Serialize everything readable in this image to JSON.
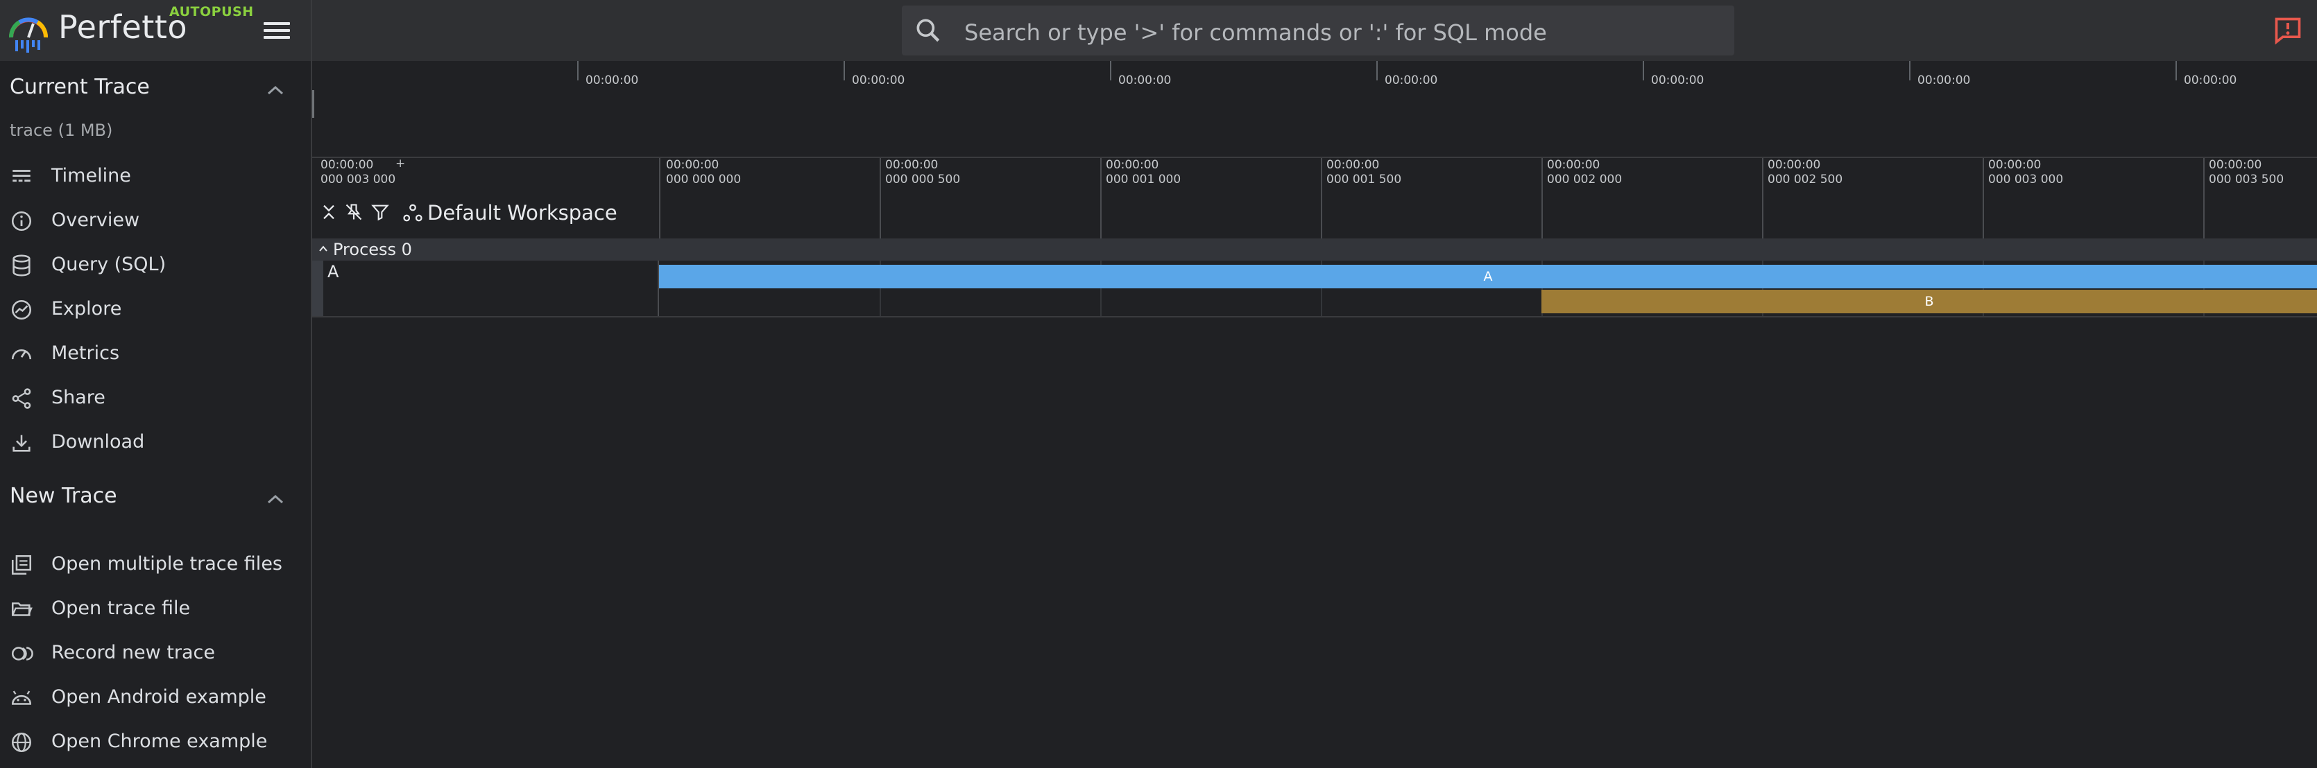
{
  "brand": {
    "name": "Perfetto",
    "channel": "AUTOPUSH",
    "channel_color": "#8bd13f"
  },
  "search": {
    "placeholder": "Search or type '>' for commands or ':' for SQL mode"
  },
  "sidebar": {
    "current_trace": {
      "title": "Current Trace",
      "trace_name": "trace (1 MB)",
      "items": [
        {
          "label": "Timeline",
          "icon": "timeline-icon"
        },
        {
          "label": "Overview",
          "icon": "info-icon"
        },
        {
          "label": "Query (SQL)",
          "icon": "database-icon"
        },
        {
          "label": "Explore",
          "icon": "explore-icon"
        },
        {
          "label": "Metrics",
          "icon": "speedometer-icon"
        },
        {
          "label": "Share",
          "icon": "share-icon"
        },
        {
          "label": "Download",
          "icon": "download-icon"
        }
      ]
    },
    "new_trace": {
      "title": "New Trace",
      "items": [
        {
          "label": "Open multiple trace files",
          "icon": "library-icon"
        },
        {
          "label": "Open trace file",
          "icon": "folder-open-icon"
        },
        {
          "label": "Record new trace",
          "icon": "record-icon"
        },
        {
          "label": "Open Android example",
          "icon": "android-icon"
        },
        {
          "label": "Open Chrome example",
          "icon": "globe-icon"
        }
      ]
    }
  },
  "overview": {
    "labels": [
      "00:00:00",
      "00:00:00",
      "00:00:00",
      "00:00:00",
      "00:00:00",
      "00:00:00",
      "00:00:00"
    ]
  },
  "timeline": {
    "offset_line1": "00:00:00",
    "offset_line2": "000 003 000",
    "offset_plus": "+",
    "workspace": "Default Workspace",
    "ticks": [
      {
        "l1": "00:00:00",
        "l2": "000 000 000"
      },
      {
        "l1": "00:00:00",
        "l2": "000 000 500"
      },
      {
        "l1": "00:00:00",
        "l2": "000 001 000"
      },
      {
        "l1": "00:00:00",
        "l2": "000 001 500"
      },
      {
        "l1": "00:00:00",
        "l2": "000 002 000"
      },
      {
        "l1": "00:00:00",
        "l2": "000 002 500"
      },
      {
        "l1": "00:00:00",
        "l2": "000 003 000"
      },
      {
        "l1": "00:00:00",
        "l2": "000 003 500"
      }
    ]
  },
  "process": {
    "name": "Process 0",
    "track": {
      "name": "A",
      "slices": [
        {
          "name": "A",
          "color": "#5aa6e8"
        },
        {
          "name": "B",
          "color": "#9e7c36"
        }
      ]
    }
  },
  "colors": {
    "background": "#202124",
    "topbar": "#2f3033",
    "alert": "#e8584d"
  }
}
